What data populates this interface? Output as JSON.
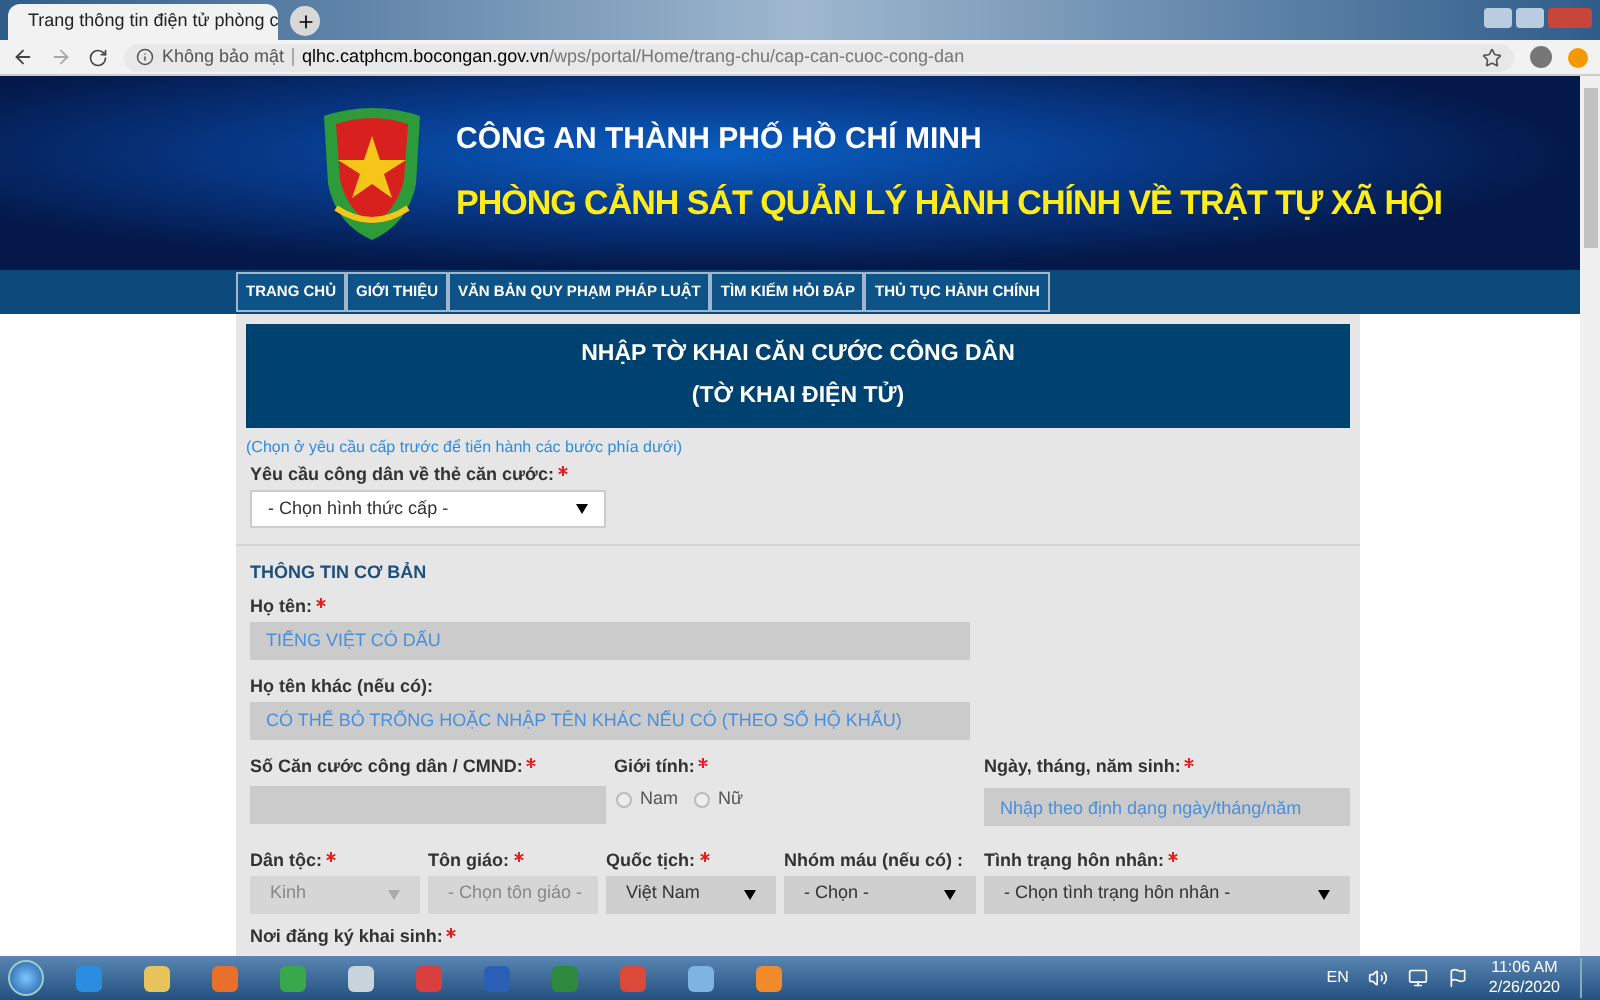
{
  "browser": {
    "tab_title": "Trang thông tin điện tử phòng c",
    "security": "Không bảo mật",
    "url_host": "qlhc.catphcm.bocongan.gov.vn",
    "url_path": "/wps/portal/Home/trang-chu/cap-can-cuoc-cong-dan"
  },
  "header": {
    "title": "CÔNG AN THÀNH PHỐ HỒ CHÍ MINH",
    "subtitle": "PHÒNG CẢNH SÁT QUẢN LÝ HÀNH CHÍNH VỀ TRẬT TỰ XÃ HỘI"
  },
  "nav": [
    {
      "label": "TRANG CHỦ"
    },
    {
      "label": "GIỚI THIỆU"
    },
    {
      "label": "VĂN BẢN QUY PHẠM PHÁP LUẬT"
    },
    {
      "label": "TÌM KIẾM HỎI ĐÁP"
    },
    {
      "label": "THỦ TỤC HÀNH CHÍNH"
    }
  ],
  "form": {
    "title": "NHẬP TỜ KHAI CĂN CƯỚC CÔNG DÂN",
    "subtitle": "(TỜ KHAI ĐIỆN TỬ)",
    "hint": "(Chọn ở yêu cầu cấp trước để tiến hành các bước phía dưới)",
    "request": {
      "label": "Yêu cầu công dân về thẻ căn cước:",
      "required": true,
      "value": "- Chọn hình thức cấp -",
      "disabled": false
    },
    "section": "THÔNG TIN CƠ BẢN",
    "full_name": {
      "label": "Họ tên:",
      "required": true,
      "placeholder": "TIẾNG VIỆT CÓ DẤU"
    },
    "other_name": {
      "label": "Họ tên khác (nếu có):",
      "required": false,
      "placeholder": "CÓ THỂ BỎ TRỐNG HOẶC NHẬP TÊN KHÁC NẾU CÓ (THEO SỔ HỘ KHẨU)"
    },
    "id_number": {
      "label": "Số Căn cước công dân / CMND:",
      "required": true
    },
    "gender": {
      "label": "Giới tính:",
      "required": true,
      "options": [
        {
          "label": "Nam",
          "selected": false
        },
        {
          "label": "Nữ",
          "selected": false
        }
      ]
    },
    "birth_date": {
      "label": "Ngày, tháng, năm sinh:",
      "required": true,
      "placeholder": "Nhập theo định dạng ngày/tháng/năm"
    },
    "selects": [
      {
        "label": "Dân tộc:",
        "required": true,
        "value": "Kinh",
        "disabled": true
      },
      {
        "label": "Tôn giáo:",
        "required": true,
        "value": "- Chọn tôn giáo -",
        "disabled": true
      },
      {
        "label": "Quốc tịch:",
        "required": true,
        "value": "Việt Nam",
        "disabled": false
      },
      {
        "label": "Nhóm máu (nếu có) :",
        "required": false,
        "value": "- Chọn -",
        "disabled": false
      },
      {
        "label": "Tình trạng hôn nhân:",
        "required": true,
        "value": "- Chọn tình trạng hôn nhân -",
        "disabled": false
      }
    ],
    "birth_place": {
      "label": "Nơi đăng ký khai sinh:",
      "required": true
    }
  },
  "taskbar": {
    "language": "EN",
    "time": "11:06 AM",
    "date": "2/26/2020"
  }
}
